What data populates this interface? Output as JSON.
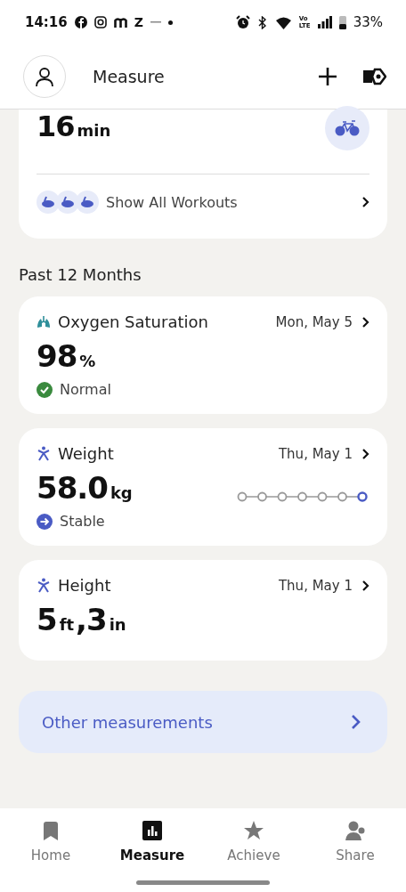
{
  "status_bar": {
    "time": "14:16",
    "app_letter": "Z",
    "network_top": "Vo",
    "network_bottom": "LTE",
    "battery": "33%"
  },
  "header": {
    "title": "Measure"
  },
  "workout_card": {
    "value": "16",
    "unit": "min",
    "link": "Show All Workouts"
  },
  "section_title": "Past 12 Months",
  "measurements": [
    {
      "kind": "oxygen",
      "title": "Oxygen Saturation",
      "date": "Mon, May 5",
      "parts": [
        {
          "kind": "number",
          "text": "98"
        },
        {
          "kind": "unit",
          "text": "%"
        }
      ],
      "status": {
        "kind": "check",
        "text": "Normal"
      }
    },
    {
      "kind": "weight",
      "title": "Weight",
      "date": "Thu, May 1",
      "parts": [
        {
          "kind": "number",
          "text": "58.0"
        },
        {
          "kind": "unit",
          "text": "kg"
        }
      ],
      "status": {
        "kind": "arrow",
        "text": "Stable"
      },
      "trend": true
    },
    {
      "kind": "height",
      "title": "Height",
      "date": "Thu, May 1",
      "parts": [
        {
          "kind": "number",
          "text": "5"
        },
        {
          "kind": "unit",
          "text": "ft"
        },
        {
          "kind": "number",
          "text": ","
        },
        {
          "kind": "number",
          "text": "3"
        },
        {
          "kind": "unit",
          "text": "in"
        }
      ]
    }
  ],
  "other_link": "Other measurements",
  "nav": [
    {
      "kind": "home",
      "label": "Home",
      "selected": false
    },
    {
      "kind": "measure",
      "label": "Measure",
      "selected": true
    },
    {
      "kind": "achieve",
      "label": "Achieve",
      "selected": false
    },
    {
      "kind": "share",
      "label": "Share",
      "selected": false
    }
  ]
}
